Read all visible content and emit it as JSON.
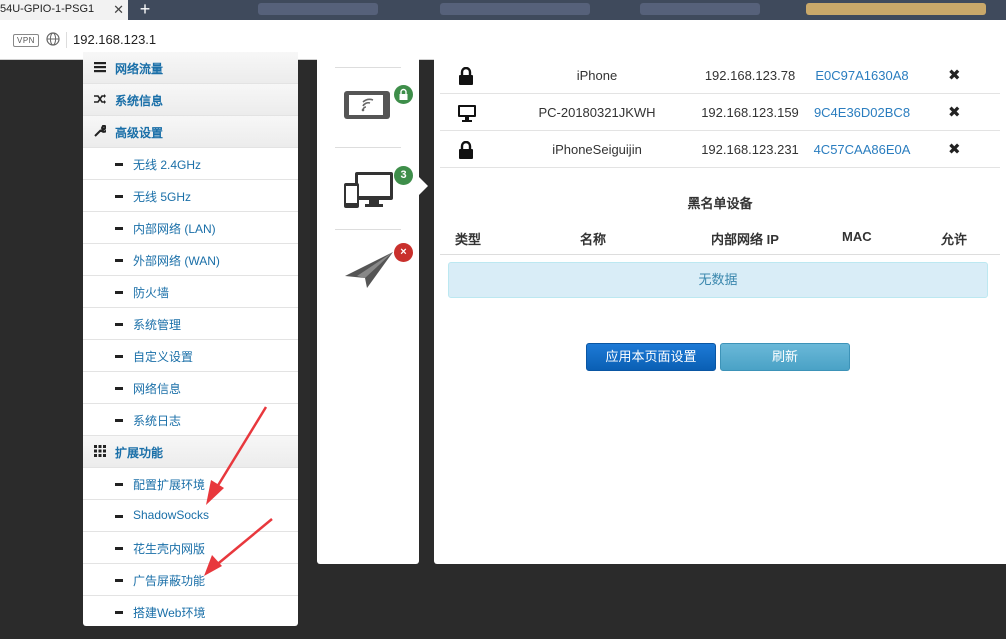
{
  "browser": {
    "tab_title": "54U-GPIO-1-PSG1",
    "vpn_label": "VPN",
    "url": "192.168.123.1"
  },
  "sidebar": {
    "items": [
      {
        "label": "网络流量",
        "type": "category",
        "icon": "list-icon"
      },
      {
        "label": "系统信息",
        "type": "category",
        "icon": "shuffle-icon"
      },
      {
        "label": "高级设置",
        "type": "category",
        "icon": "wrench-icon"
      },
      {
        "label": "无线 2.4GHz",
        "type": "sub"
      },
      {
        "label": "无线 5GHz",
        "type": "sub"
      },
      {
        "label": "内部网络 (LAN)",
        "type": "sub"
      },
      {
        "label": "外部网络 (WAN)",
        "type": "sub"
      },
      {
        "label": "防火墙",
        "type": "sub"
      },
      {
        "label": "系统管理",
        "type": "sub"
      },
      {
        "label": "自定义设置",
        "type": "sub"
      },
      {
        "label": "网络信息",
        "type": "sub"
      },
      {
        "label": "系统日志",
        "type": "sub"
      },
      {
        "label": "扩展功能",
        "type": "category",
        "icon": "grid-icon"
      },
      {
        "label": "配置扩展环境",
        "type": "sub"
      },
      {
        "label": "ShadowSocks",
        "type": "sub"
      },
      {
        "label": "花生壳内网版",
        "type": "sub"
      },
      {
        "label": "广告屏蔽功能",
        "type": "sub"
      },
      {
        "label": "搭建Web环境",
        "type": "sub"
      }
    ]
  },
  "device_panel": {
    "wireless_badge": "lock",
    "wired_count": "3",
    "blocked_badge": "×"
  },
  "clients": [
    {
      "icon": "lock-icon",
      "name": "iPhone",
      "ip": "192.168.123.78",
      "mac": "E0C97A1630A8"
    },
    {
      "icon": "monitor-icon",
      "name": "PC-20180321JKWH",
      "ip": "192.168.123.159",
      "mac": "9C4E36D02BC8"
    },
    {
      "icon": "lock-icon",
      "name": "iPhoneSeiguijin",
      "ip": "192.168.123.231",
      "mac": "4C57CAA86E0A"
    }
  ],
  "blacklist": {
    "title": "黑名单设备",
    "headers": [
      "类型",
      "名称",
      "内部网络 IP",
      "MAC",
      "允许"
    ],
    "empty_text": "无数据"
  },
  "buttons": {
    "apply": "应用本页面设置",
    "refresh": "刷新"
  },
  "colors": {
    "link": "#1a6fa8",
    "mac": "#2a7dbf",
    "apply_button": "#0a5fb4",
    "refresh_button": "#4aa2c6",
    "badge_green": "#3e8e4a",
    "badge_red": "#c9302c",
    "annotation_arrow": "#e8383d"
  }
}
